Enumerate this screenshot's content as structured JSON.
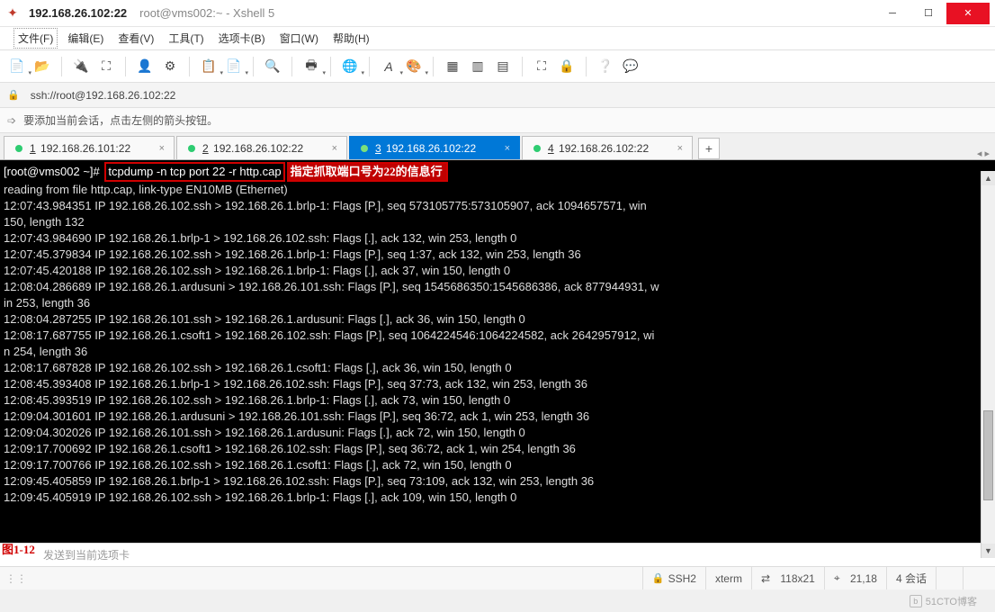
{
  "title": {
    "main": "192.168.26.102:22",
    "sub": "root@vms002:~ - Xshell 5"
  },
  "menu": [
    "文件(F)",
    "编辑(E)",
    "查看(V)",
    "工具(T)",
    "选项卡(B)",
    "窗口(W)",
    "帮助(H)"
  ],
  "address": "ssh://root@192.168.26.102:22",
  "tip": "要添加当前会话，点击左侧的箭头按钮。",
  "tabs": [
    {
      "num": "1",
      "label": "192.168.26.101:22",
      "active": false
    },
    {
      "num": "2",
      "label": "192.168.26.102:22",
      "active": false
    },
    {
      "num": "3",
      "label": "192.168.26.102:22",
      "active": true
    },
    {
      "num": "4",
      "label": "192.168.26.102:22",
      "active": false
    }
  ],
  "terminal": {
    "prompt": "[root@vms002 ~]# ",
    "command": "tcpdump -n tcp port 22 -r http.cap",
    "note": "指定抓取端口号为22的信息行",
    "lines": [
      "reading from file http.cap, link-type EN10MB (Ethernet)",
      "12:07:43.984351 IP 192.168.26.102.ssh > 192.168.26.1.brlp-1: Flags [P.], seq 573105775:573105907, ack 1094657571, win",
      "150, length 132",
      "12:07:43.984690 IP 192.168.26.1.brlp-1 > 192.168.26.102.ssh: Flags [.], ack 132, win 253, length 0",
      "12:07:45.379834 IP 192.168.26.102.ssh > 192.168.26.1.brlp-1: Flags [P.], seq 1:37, ack 132, win 253, length 36",
      "12:07:45.420188 IP 192.168.26.102.ssh > 192.168.26.1.brlp-1: Flags [.], ack 37, win 150, length 0",
      "12:08:04.286689 IP 192.168.26.1.ardusuni > 192.168.26.101.ssh: Flags [P.], seq 1545686350:1545686386, ack 877944931, w",
      "in 253, length 36",
      "12:08:04.287255 IP 192.168.26.101.ssh > 192.168.26.1.ardusuni: Flags [.], ack 36, win 150, length 0",
      "12:08:17.687755 IP 192.168.26.1.csoft1 > 192.168.26.102.ssh: Flags [P.], seq 1064224546:1064224582, ack 2642957912, wi",
      "n 254, length 36",
      "12:08:17.687828 IP 192.168.26.102.ssh > 192.168.26.1.csoft1: Flags [.], ack 36, win 150, length 0",
      "12:08:45.393408 IP 192.168.26.1.brlp-1 > 192.168.26.102.ssh: Flags [P.], seq 37:73, ack 132, win 253, length 36",
      "12:08:45.393519 IP 192.168.26.102.ssh > 192.168.26.1.brlp-1: Flags [.], ack 73, win 150, length 0",
      "12:09:04.301601 IP 192.168.26.1.ardusuni > 192.168.26.101.ssh: Flags [P.], seq 36:72, ack 1, win 253, length 36",
      "12:09:04.302026 IP 192.168.26.101.ssh > 192.168.26.1.ardusuni: Flags [.], ack 72, win 150, length 0",
      "12:09:17.700692 IP 192.168.26.1.csoft1 > 192.168.26.102.ssh: Flags [P.], seq 36:72, ack 1, win 254, length 36",
      "12:09:17.700766 IP 192.168.26.102.ssh > 192.168.26.1.csoft1: Flags [.], ack 72, win 150, length 0",
      "12:09:45.405859 IP 192.168.26.1.brlp-1 > 192.168.26.102.ssh: Flags [P.], seq 73:109, ack 132, win 253, length 36",
      "12:09:45.405919 IP 192.168.26.102.ssh > 192.168.26.1.brlp-1: Flags [.], ack 109, win 150, length 0"
    ]
  },
  "sendbar_placeholder": "发送到当前选项卡",
  "fig_label": "图1-12",
  "status": {
    "ssh": "SSH2",
    "term": "xterm",
    "size": "118x21",
    "pos": "21,18",
    "sess": "4 会话"
  },
  "watermark": "51CTO博客"
}
